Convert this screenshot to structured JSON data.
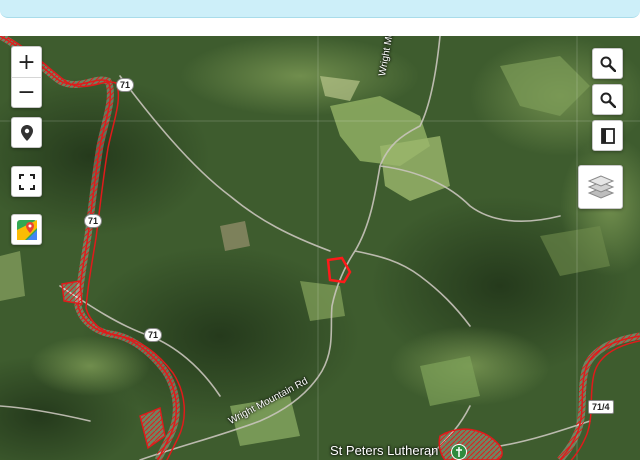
{
  "controls": {
    "zoom_in_label": "+",
    "zoom_out_label": "−"
  },
  "map": {
    "road_labels": {
      "wright_mountain_rd": "Wright Mountain Rd",
      "wright_mountain_top": "Wright Mountain"
    },
    "place_labels": {
      "church": "St Peters Lutheran"
    },
    "route_shields": [
      "71",
      "71",
      "71",
      "71/4"
    ],
    "colors": {
      "boundary": "#e01b1b",
      "forest": "#3b5a2c",
      "field": "#8fae63",
      "road": "#c9c5bc"
    }
  }
}
